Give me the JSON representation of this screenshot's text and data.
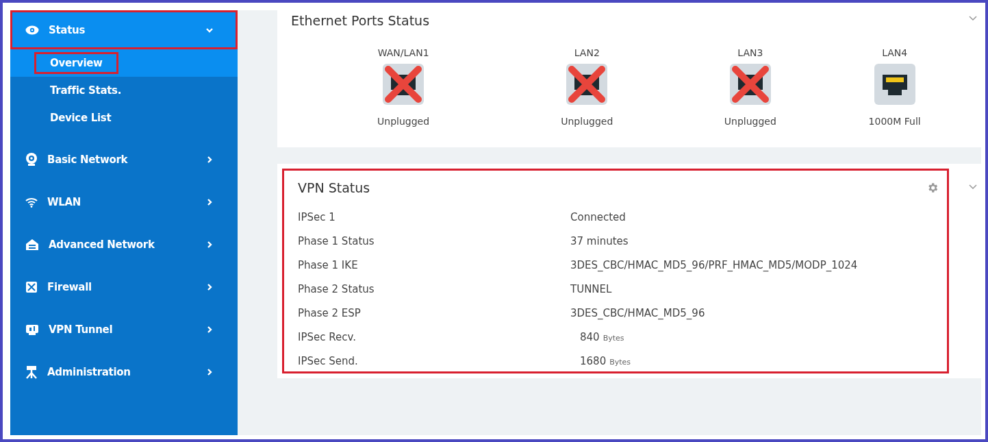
{
  "sidebar": {
    "items": [
      {
        "label": "Status",
        "expanded": true,
        "highlighted": true,
        "children": [
          {
            "label": "Overview",
            "selected": true,
            "highlighted": true
          },
          {
            "label": "Traffic Stats.",
            "selected": false,
            "highlighted": false
          },
          {
            "label": "Device List",
            "selected": false,
            "highlighted": false
          }
        ]
      },
      {
        "label": "Basic Network",
        "expanded": false,
        "highlighted": false
      },
      {
        "label": "WLAN",
        "expanded": false,
        "highlighted": false
      },
      {
        "label": "Advanced Network",
        "expanded": false,
        "highlighted": false
      },
      {
        "label": "Firewall",
        "expanded": false,
        "highlighted": false
      },
      {
        "label": "VPN Tunnel",
        "expanded": false,
        "highlighted": false
      },
      {
        "label": "Administration",
        "expanded": false,
        "highlighted": false
      }
    ]
  },
  "ethernet": {
    "title": "Ethernet Ports Status",
    "ports": [
      {
        "name": "WAN/LAN1",
        "plugged": false,
        "status": "Unplugged"
      },
      {
        "name": "LAN2",
        "plugged": false,
        "status": "Unplugged"
      },
      {
        "name": "LAN3",
        "plugged": false,
        "status": "Unplugged"
      },
      {
        "name": "LAN4",
        "plugged": true,
        "status": "1000M Full"
      }
    ]
  },
  "vpn": {
    "title": "VPN Status",
    "highlighted": true,
    "rows": [
      {
        "label": "IPSec 1",
        "value": "Connected"
      },
      {
        "label": "Phase 1 Status",
        "value": "37 minutes"
      },
      {
        "label": "Phase 1 IKE",
        "value": "3DES_CBC/HMAC_MD5_96/PRF_HMAC_MD5/MODP_1024"
      },
      {
        "label": "Phase 2 Status",
        "value": "TUNNEL"
      },
      {
        "label": "Phase 2 ESP",
        "value": "3DES_CBC/HMAC_MD5_96"
      },
      {
        "label": "IPSec Recv.",
        "value": "840",
        "unit": "Bytes"
      },
      {
        "label": "IPSec Send.",
        "value": "1680",
        "unit": "Bytes"
      }
    ]
  }
}
